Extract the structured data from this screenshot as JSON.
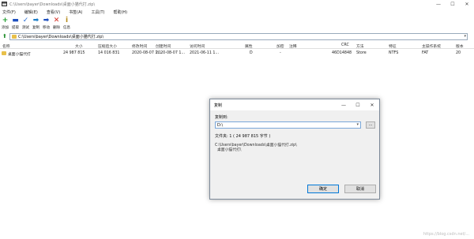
{
  "window": {
    "title": "C:\\Users\\bayer\\Downloads\\桌面小猫代打.zip\\"
  },
  "menu": [
    "文件(F)",
    "编辑(E)",
    "查看(V)",
    "书签(A)",
    "工具(T)",
    "帮助(H)"
  ],
  "toolbar": [
    {
      "label": "添加",
      "icon": "plus-icon",
      "glyph": "+",
      "color": "#1f9e2e"
    },
    {
      "label": "提取",
      "icon": "minus-icon",
      "glyph": "▬",
      "color": "#1d4fbf"
    },
    {
      "label": "测试",
      "icon": "check-icon",
      "glyph": "✓",
      "color": "#2a6fd6"
    },
    {
      "label": "复制",
      "icon": "arrow-right-icon",
      "glyph": "➡",
      "color": "#1d7fc9"
    },
    {
      "label": "移动",
      "icon": "arrow-right-icon",
      "glyph": "➡",
      "color": "#1d4fbf"
    },
    {
      "label": "删除",
      "icon": "delete-icon",
      "glyph": "✕",
      "color": "#d42a1f"
    },
    {
      "label": "信息",
      "icon": "info-icon",
      "glyph": "i",
      "color": "#b58a16"
    }
  ],
  "address": {
    "path": "C:\\Users\\bayer\\Downloads\\桌面小猫代打.zip\\"
  },
  "columns": [
    "名称",
    "大小",
    "压缩后大小",
    "修改时间",
    "创建时间",
    "访问时间",
    "属性",
    "加密",
    "注释",
    "CRC",
    "方法",
    "特征",
    "主操作系统",
    "版本"
  ],
  "files": [
    {
      "name": "桌面小猫代打",
      "size": "24 987 815",
      "packed": "14 016 831",
      "modified": "2020-08-07 1...",
      "created": "2020-08-07 1...",
      "accessed": "2021-06-11 1...",
      "attr": "D",
      "encrypted": "-",
      "comment": "",
      "crc": "46D14848",
      "method": "Store",
      "characteristics": "NTFS",
      "host_os": "FAT",
      "version": "20"
    }
  ],
  "dialog": {
    "title": "复制",
    "copy_to_label": "复制到:",
    "destination": "D:\\",
    "browse_label": "...",
    "folder_info": "文件夹: 1   ( 24 987 815 字节 )",
    "source_path": "C:\\Users\\bayer\\Downloads\\桌面小猫代打.zip\\",
    "source_item": "桌面小猫代打\\",
    "ok_label": "确定",
    "cancel_label": "取消"
  },
  "watermark": "https://blog.csdn.net/..."
}
